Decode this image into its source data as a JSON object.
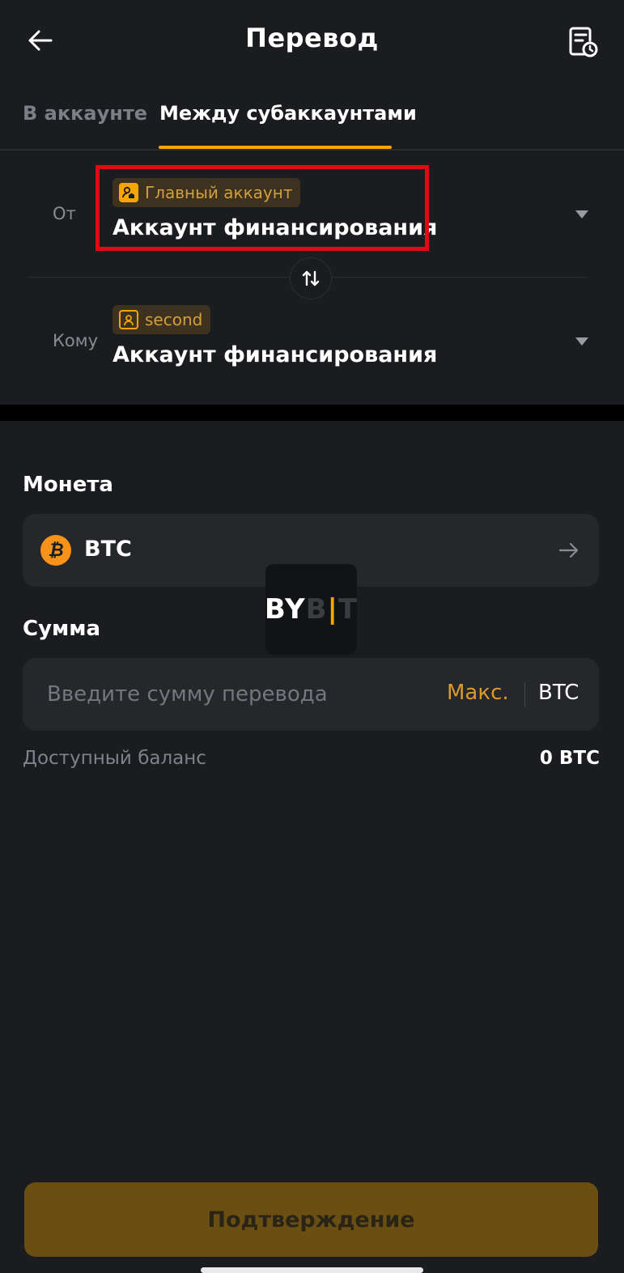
{
  "header": {
    "title": "Перевод",
    "back_icon": "arrow-left-icon",
    "history_icon": "history-document-icon"
  },
  "tabs": [
    {
      "label": "В аккаунте",
      "active": false
    },
    {
      "label": "Между субаккаунтами",
      "active": true
    }
  ],
  "from": {
    "label": "От",
    "badge": "Главный аккаунт",
    "badge_icon": "main-account-icon",
    "account": "Аккаунт финансирования"
  },
  "to": {
    "label": "Кому",
    "badge": "second",
    "badge_icon": "sub-account-icon",
    "account": "Аккаунт финансирования"
  },
  "coin": {
    "label": "Монета",
    "symbol": "BTC",
    "icon_glyph": "₿"
  },
  "amount": {
    "label": "Сумма",
    "placeholder": "Введите сумму перевода",
    "max_label": "Макс.",
    "unit": "BTC"
  },
  "balance": {
    "label": "Доступный баланс",
    "value": "0 BTC"
  },
  "watermark": {
    "part1": "BY",
    "part2": "B",
    "part3": "T"
  },
  "confirm_label": "Подтверждение",
  "colors": {
    "accent": "#f7a600",
    "highlight": "#e10a12",
    "background": "#1b1c1f"
  }
}
